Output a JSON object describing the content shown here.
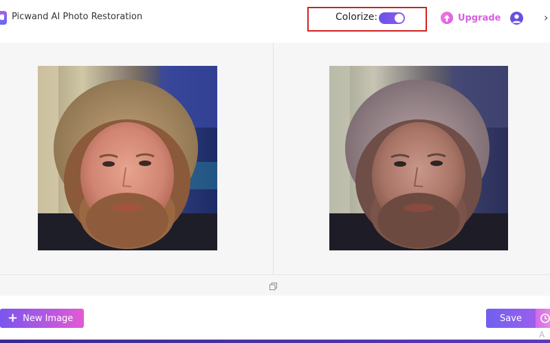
{
  "header": {
    "app_title": "Picwand AI Photo Restoration",
    "colorize_label": "Colorize:",
    "colorize_enabled": true,
    "upgrade_label": "Upgrade",
    "close_glyph": "›"
  },
  "actions": {
    "new_image_plus": "+",
    "new_image_label": "New Image",
    "save_label": "Save"
  },
  "footer": {
    "corner_text": "A"
  },
  "icons": {
    "logo": "picwand-logo-icon",
    "upgrade": "arrow-up-icon",
    "user": "user-icon",
    "close": "chevron-right-icon",
    "compare": "copy-compare-icon",
    "history": "clock-icon"
  },
  "colors": {
    "accent_purple": "#6a4fe3",
    "accent_pink": "#d65fe0",
    "highlight_border": "#d21f1f"
  }
}
